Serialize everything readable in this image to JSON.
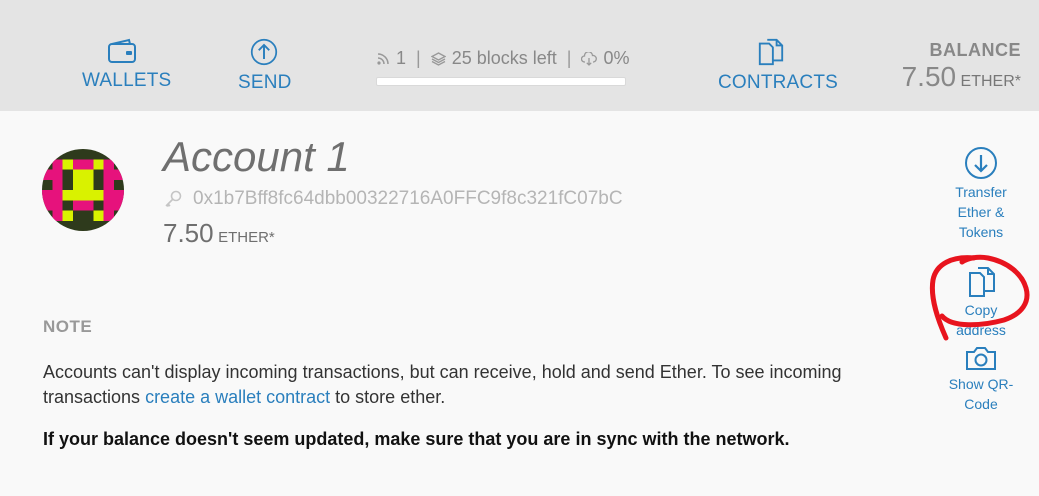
{
  "nav": {
    "wallets_label": "WALLETS",
    "send_label": "SEND",
    "contracts_label": "CONTRACTS"
  },
  "sync": {
    "peers": "1",
    "blocks_left": "25 blocks left",
    "progress_text": "0%",
    "progress_fraction": 0
  },
  "balance": {
    "label": "BALANCE",
    "value": "7.50",
    "unit": "ETHER*"
  },
  "account": {
    "title": "Account 1",
    "address": "0x1b7Bff8fc64dbb00322716A0FFC9f8c321fC07bC",
    "balance_value": "7.50",
    "balance_unit": "ETHER*"
  },
  "actions": {
    "transfer_label": "Transfer Ether & Tokens",
    "copy_label": "Copy address",
    "qr_label": "Show QR-Code"
  },
  "note": {
    "label": "NOTE",
    "text_before": "Accounts can't display incoming transactions, but can receive, hold and send Ether. To see incoming transactions ",
    "link_text": "create a wallet contract",
    "text_after": " to store ether.",
    "bold_text": "If your balance doesn't seem updated, make sure that you are in sync with the network."
  },
  "colors": {
    "accent": "#2a7fbd",
    "annotation": "#e8141e",
    "avatar_dark": "#2e3a1c",
    "avatar_pink": "#e6127c",
    "avatar_yellow": "#d9f200"
  }
}
